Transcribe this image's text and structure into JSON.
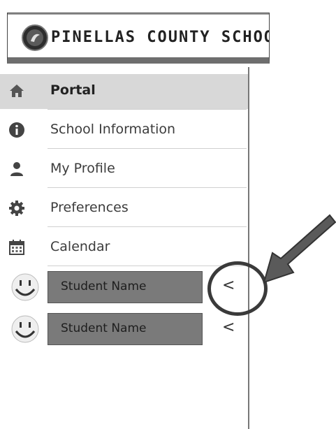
{
  "header": {
    "logo_text": "PINELLAS COUNTY SCHOOL"
  },
  "sidebar": {
    "items": [
      {
        "label": "Portal",
        "icon": "home-icon",
        "active": true
      },
      {
        "label": "School Information",
        "icon": "info-icon"
      },
      {
        "label": "My Profile",
        "icon": "user-icon"
      },
      {
        "label": "Preferences",
        "icon": "gear-icon"
      },
      {
        "label": "Calendar",
        "icon": "calendar-icon"
      }
    ],
    "students": [
      {
        "label": "Student Name",
        "avatar": "smiley-icon",
        "chevron": "<"
      },
      {
        "label": "Student Name",
        "avatar": "smiley-icon",
        "chevron": "<"
      }
    ]
  },
  "colors": {
    "active_bg": "#d8d8d8",
    "student_bg": "#7a7a7a",
    "annotation": "#3a3a3a"
  }
}
